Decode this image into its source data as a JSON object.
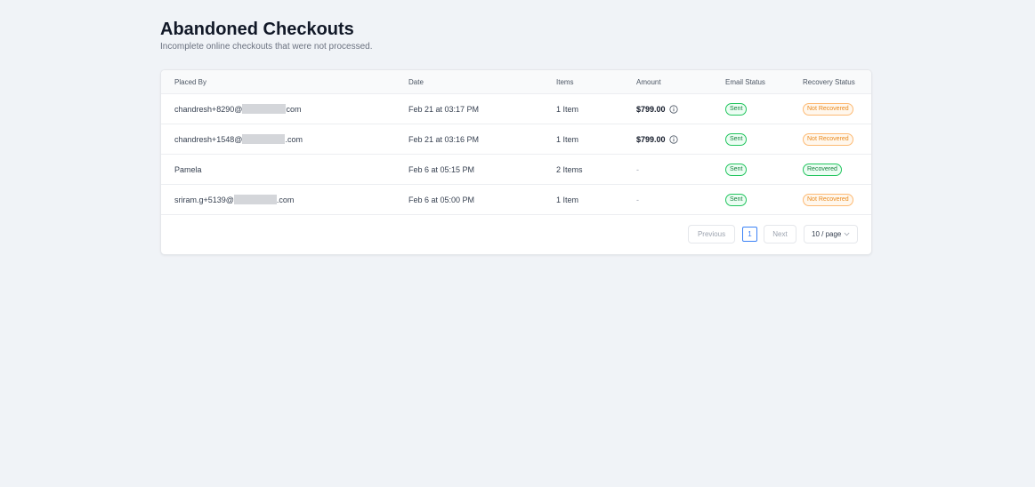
{
  "header": {
    "title": "Abandoned Checkouts",
    "subtitle": "Incomplete online checkouts that were not processed."
  },
  "table": {
    "columns": [
      "Placed By",
      "Date",
      "Items",
      "Amount",
      "Email Status",
      "Recovery Status"
    ],
    "rows": [
      {
        "placed_by_prefix": "chandresh+8290@",
        "placed_by_suffix": "com",
        "date": "Feb 21 at 03:17 PM",
        "items": "1 Item",
        "amount": "$799.00",
        "email_status": "Sent",
        "recovery_status": "Not Recovered"
      },
      {
        "placed_by_prefix": "chandresh+1548@",
        "placed_by_suffix": ".com",
        "date": "Feb 21 at 03:16 PM",
        "items": "1 Item",
        "amount": "$799.00",
        "email_status": "Sent",
        "recovery_status": "Not Recovered"
      },
      {
        "placed_by_prefix": "Pamela",
        "placed_by_suffix": "",
        "date": "Feb 6 at 05:15 PM",
        "items": "2 Items",
        "amount": "-",
        "email_status": "Sent",
        "recovery_status": "Recovered"
      },
      {
        "placed_by_prefix": "sriram.g+5139@",
        "placed_by_suffix": ".com",
        "date": "Feb 6 at 05:00 PM",
        "items": "1 Item",
        "amount": "-",
        "email_status": "Sent",
        "recovery_status": "Not Recovered"
      }
    ]
  },
  "pagination": {
    "previous_label": "Previous",
    "current_page": "1",
    "next_label": "Next",
    "page_size_label": "10 / page"
  },
  "colors": {
    "background": "#f0f3f7",
    "sent_green": "#15803d",
    "not_recovered_orange": "#ea8a1e",
    "active_page_blue": "#3b82f6"
  }
}
